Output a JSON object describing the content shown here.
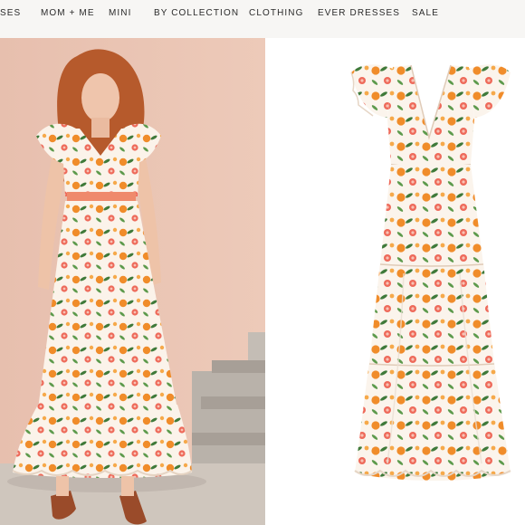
{
  "nav": {
    "items": [
      "SES",
      "MOM + ME",
      "MINI",
      "BY COLLECTION",
      "CLOTHING",
      "EVER DRESSES",
      "SALE"
    ]
  },
  "images": {
    "left": "model-photo",
    "right": "product-photo"
  },
  "colors": {
    "nav_bg": "#f7f6f4",
    "wall": "#e9c4b4",
    "steps": "#b9b2aa",
    "dress_base": "#fbf3ea",
    "orange": "#f08c2a",
    "grapefruit": "#ee6a5a",
    "leaf": "#3f7a3a"
  }
}
